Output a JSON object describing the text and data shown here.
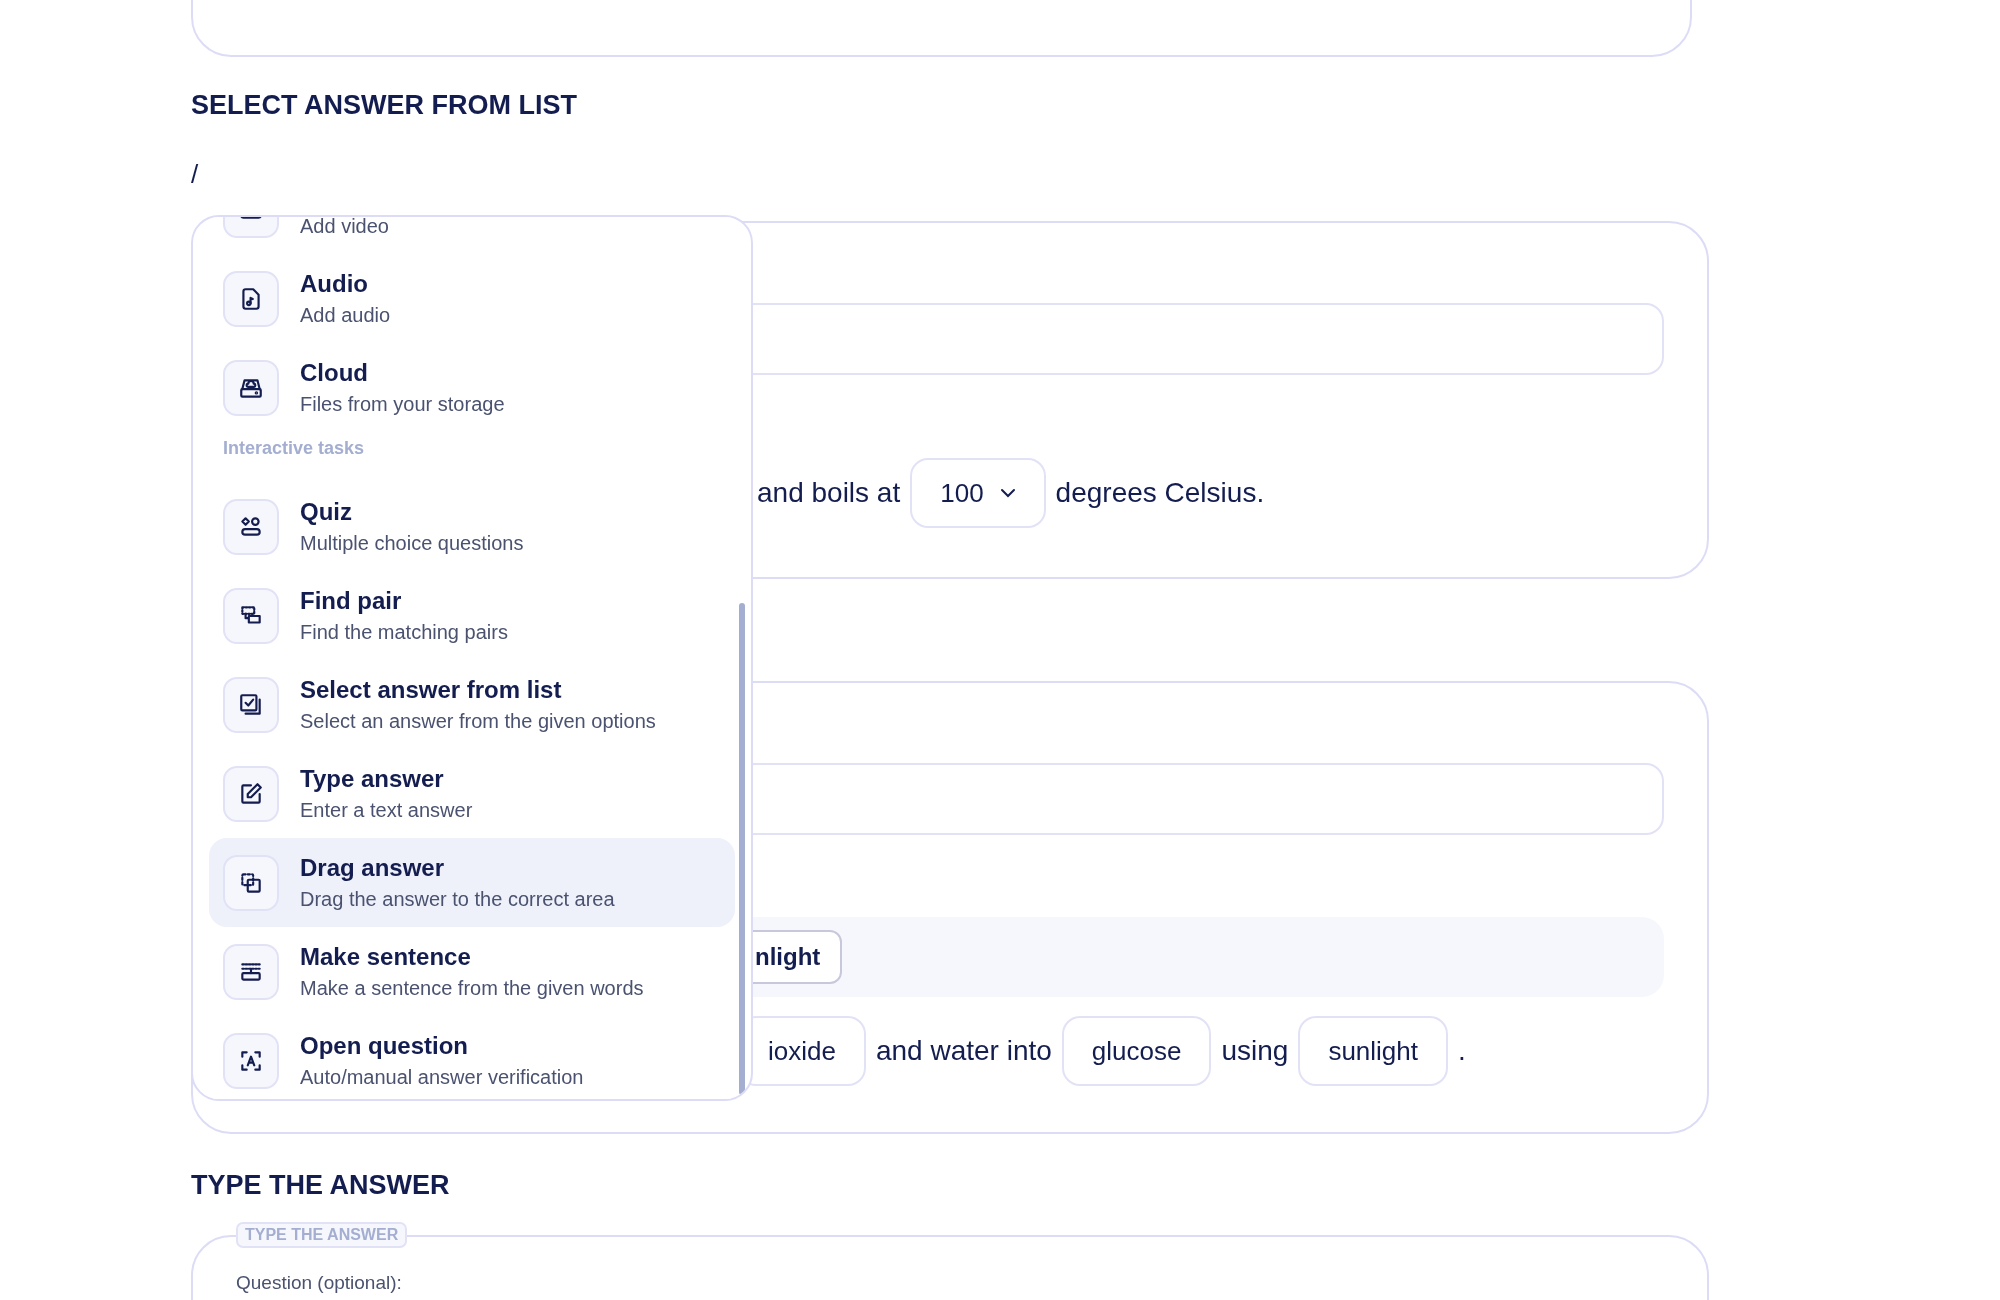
{
  "section_heading_1": "SELECT ANSWER FROM LIST",
  "command_input": "/",
  "insert_menu": {
    "items": [
      {
        "kind": "item",
        "subtitle": "Add video",
        "selected": false
      },
      {
        "kind": "item",
        "title": "Audio",
        "subtitle": "Add audio",
        "selected": false
      },
      {
        "kind": "item",
        "title": "Cloud",
        "subtitle": "Files from your storage",
        "selected": false
      },
      {
        "kind": "group_label",
        "title": "Interactive tasks"
      },
      {
        "kind": "item",
        "title": "Quiz",
        "subtitle": "Multiple choice questions",
        "selected": false
      },
      {
        "kind": "item",
        "title": "Find pair",
        "subtitle": "Find the matching pairs",
        "selected": false
      },
      {
        "kind": "item",
        "title": "Select answer from list",
        "subtitle": "Select an answer from the given options",
        "selected": false
      },
      {
        "kind": "item",
        "title": "Type answer",
        "subtitle": "Enter a text answer",
        "selected": false
      },
      {
        "kind": "item",
        "title": "Drag answer",
        "subtitle": "Drag the answer to the correct area",
        "selected": true
      },
      {
        "kind": "item",
        "title": "Make sentence",
        "subtitle": "Make a sentence from the given words",
        "selected": false
      },
      {
        "kind": "item",
        "title": "Open question",
        "subtitle": "Auto/manual answer verification",
        "selected": false
      }
    ]
  },
  "select_card": {
    "sentence": [
      {
        "kind": "text",
        "text": "and boils at"
      },
      {
        "kind": "dropdown",
        "text": "100"
      },
      {
        "kind": "text",
        "text": "degrees Celsius."
      }
    ]
  },
  "drag_card": {
    "answer_pool": [
      {
        "text": "nlight"
      }
    ],
    "sentence": [
      {
        "kind": "chip",
        "text": "ioxide"
      },
      {
        "kind": "text",
        "text": "and water into"
      },
      {
        "kind": "chip",
        "text": "glucose"
      },
      {
        "kind": "text",
        "text": "using"
      },
      {
        "kind": "chip",
        "text": "sunlight"
      },
      {
        "kind": "text",
        "text": "."
      }
    ]
  },
  "section_heading_2": "TYPE THE ANSWER",
  "type_card": {
    "legend": "TYPE THE ANSWER",
    "question_label": "Question (optional):"
  }
}
